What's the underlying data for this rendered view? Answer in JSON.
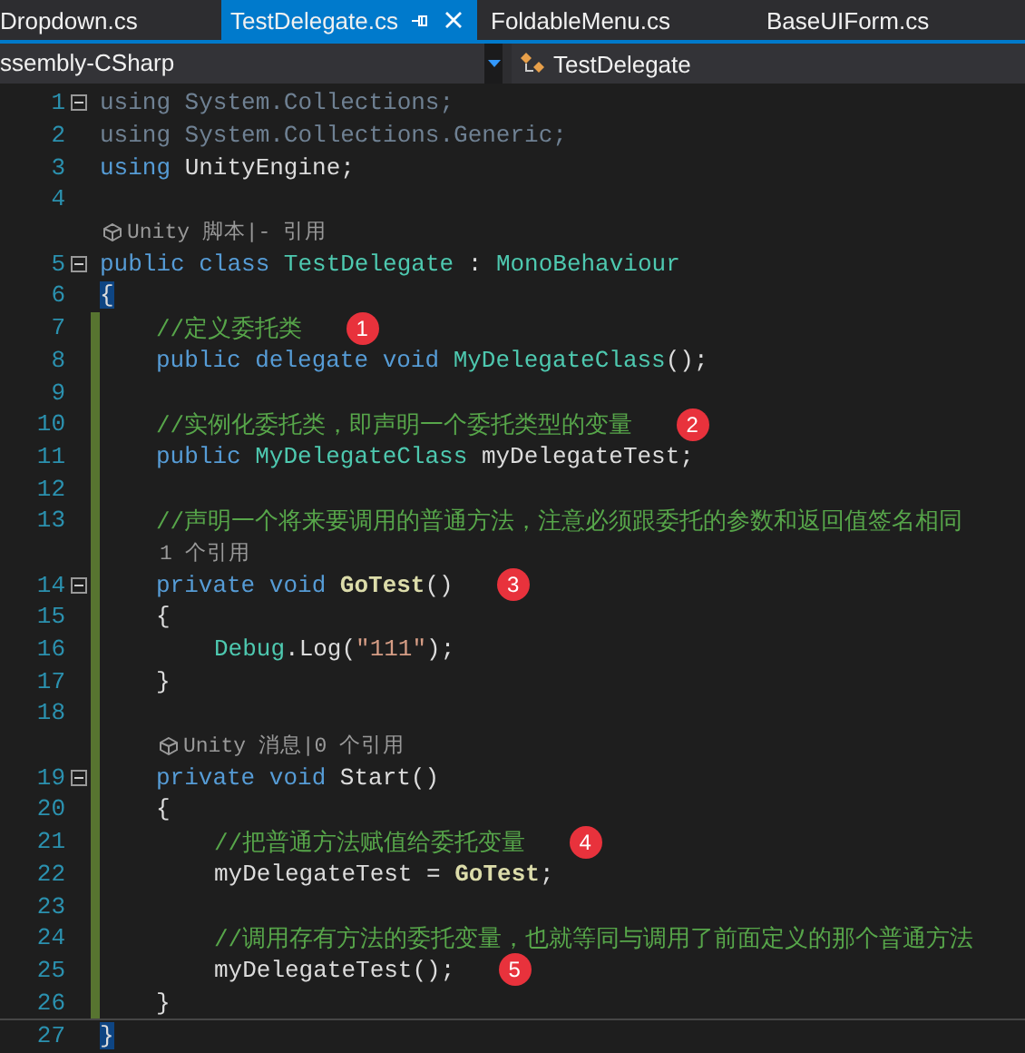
{
  "tabs": [
    {
      "label": "Dropdown.cs",
      "selected": false
    },
    {
      "label": "TestDelegate.cs",
      "selected": true
    },
    {
      "label": "FoldableMenu.cs",
      "selected": false
    },
    {
      "label": "BaseUIForm.cs",
      "selected": false
    }
  ],
  "navigation": {
    "project": "ssembly-CSharp",
    "member": "TestDelegate"
  },
  "lines": [
    {
      "number": "1",
      "kind": "top",
      "fold": true,
      "changed": false,
      "tokens": [
        {
          "kind": "unused",
          "text": "using System.Collections;"
        }
      ]
    },
    {
      "number": "2",
      "kind": "top",
      "fold": false,
      "changed": false,
      "tokens": [
        {
          "kind": "unused",
          "text": "using System.Collections.Generic;"
        }
      ]
    },
    {
      "number": "3",
      "kind": "top",
      "fold": false,
      "changed": false,
      "tokens": [
        {
          "kind": "keyword",
          "text": "using"
        },
        {
          "kind": "plain",
          "text": " UnityEngine;"
        }
      ]
    },
    {
      "number": "4",
      "kind": "top",
      "fold": false,
      "changed": false
    },
    {
      "number": "5",
      "kind": "top",
      "fold": true,
      "changed": false,
      "lens": "Unity 脚本|- 引用",
      "lens_icon": true,
      "tokens": [
        {
          "kind": "keyword",
          "text": "public class"
        },
        {
          "kind": "type",
          "text": " TestDelegate"
        },
        {
          "kind": "plain",
          "text": " : "
        },
        {
          "kind": "type",
          "text": "MonoBehaviour"
        }
      ]
    },
    {
      "number": "6",
      "kind": "top",
      "fold": false,
      "changed": false,
      "tokens": [
        {
          "kind": "brace",
          "text": "{"
        }
      ]
    },
    {
      "number": "7",
      "kind": "member",
      "fold": false,
      "changed": true,
      "callout": "1",
      "tokens": [
        {
          "kind": "comment",
          "text": "//定义委托类"
        }
      ]
    },
    {
      "number": "8",
      "kind": "member",
      "fold": false,
      "changed": true,
      "tokens": [
        {
          "kind": "keyword",
          "text": "public delegate void"
        },
        {
          "kind": "type",
          "text": " MyDelegateClass"
        },
        {
          "kind": "plain",
          "text": "();"
        }
      ]
    },
    {
      "number": "9",
      "kind": "member",
      "fold": false,
      "changed": true
    },
    {
      "number": "10",
      "kind": "member",
      "fold": false,
      "changed": true,
      "callout": "2",
      "tokens": [
        {
          "kind": "comment",
          "text": "//实例化委托类，即声明一个委托类型的变量"
        }
      ]
    },
    {
      "number": "11",
      "kind": "member",
      "fold": false,
      "changed": true,
      "tokens": [
        {
          "kind": "keyword",
          "text": "public"
        },
        {
          "kind": "type",
          "text": " MyDelegateClass"
        },
        {
          "kind": "plain",
          "text": " myDelegateTest;"
        }
      ]
    },
    {
      "number": "12",
      "kind": "member",
      "fold": false,
      "changed": true
    },
    {
      "number": "13",
      "kind": "member",
      "fold": false,
      "changed": true,
      "tokens": [
        {
          "kind": "comment",
          "text": "//声明一个将来要调用的普通方法，注意必须跟委托的参数和返回值签名相同"
        }
      ]
    },
    {
      "number": "14",
      "kind": "member",
      "fold": true,
      "changed": true,
      "lens": "1 个引用",
      "lens_icon": false,
      "callout": "3",
      "tokens": [
        {
          "kind": "keyword",
          "text": "private void"
        },
        {
          "kind": "method",
          "text": " GoTest"
        },
        {
          "kind": "plain",
          "text": "()"
        }
      ]
    },
    {
      "number": "15",
      "kind": "member",
      "fold": false,
      "changed": true,
      "tokens": [
        {
          "kind": "plain",
          "text": "{"
        }
      ]
    },
    {
      "number": "16",
      "kind": "statement",
      "fold": false,
      "changed": true,
      "tokens": [
        {
          "kind": "type",
          "text": "Debug"
        },
        {
          "kind": "plain",
          "text": ".Log("
        },
        {
          "kind": "string",
          "text": "\"111\""
        },
        {
          "kind": "plain",
          "text": ");"
        }
      ]
    },
    {
      "number": "17",
      "kind": "member",
      "fold": false,
      "changed": true,
      "tokens": [
        {
          "kind": "plain",
          "text": "}"
        }
      ]
    },
    {
      "number": "18",
      "kind": "member",
      "fold": false,
      "changed": true
    },
    {
      "number": "19",
      "kind": "member",
      "fold": true,
      "changed": true,
      "lens": "Unity 消息|0 个引用",
      "lens_icon": true,
      "tokens": [
        {
          "kind": "keyword",
          "text": "private void"
        },
        {
          "kind": "plain",
          "text": " Start()"
        }
      ]
    },
    {
      "number": "20",
      "kind": "member",
      "fold": false,
      "changed": true,
      "tokens": [
        {
          "kind": "plain",
          "text": "{"
        }
      ]
    },
    {
      "number": "21",
      "kind": "statement",
      "fold": false,
      "changed": true,
      "callout": "4",
      "tokens": [
        {
          "kind": "comment",
          "text": "//把普通方法赋值给委托变量"
        }
      ]
    },
    {
      "number": "22",
      "kind": "statement",
      "fold": false,
      "changed": true,
      "tokens": [
        {
          "kind": "plain",
          "text": "myDelegateTest = "
        },
        {
          "kind": "method",
          "text": "GoTest"
        },
        {
          "kind": "plain",
          "text": ";"
        }
      ]
    },
    {
      "number": "23",
      "kind": "statement",
      "fold": false,
      "changed": true
    },
    {
      "number": "24",
      "kind": "statement",
      "fold": false,
      "changed": true,
      "tokens": [
        {
          "kind": "comment",
          "text": "//调用存有方法的委托变量，也就等同与调用了前面定义的那个普通方法"
        }
      ]
    },
    {
      "number": "25",
      "kind": "statement",
      "fold": false,
      "changed": true,
      "callout": "5",
      "tokens": [
        {
          "kind": "plain",
          "text": "myDelegateTest();"
        }
      ]
    },
    {
      "number": "26",
      "kind": "member",
      "fold": false,
      "changed": true,
      "tokens": [
        {
          "kind": "plain",
          "text": "}"
        }
      ]
    },
    {
      "number": "27",
      "kind": "top",
      "fold": false,
      "changed": false,
      "current": true,
      "tokens": [
        {
          "kind": "brace",
          "text": "}"
        }
      ]
    }
  ]
}
